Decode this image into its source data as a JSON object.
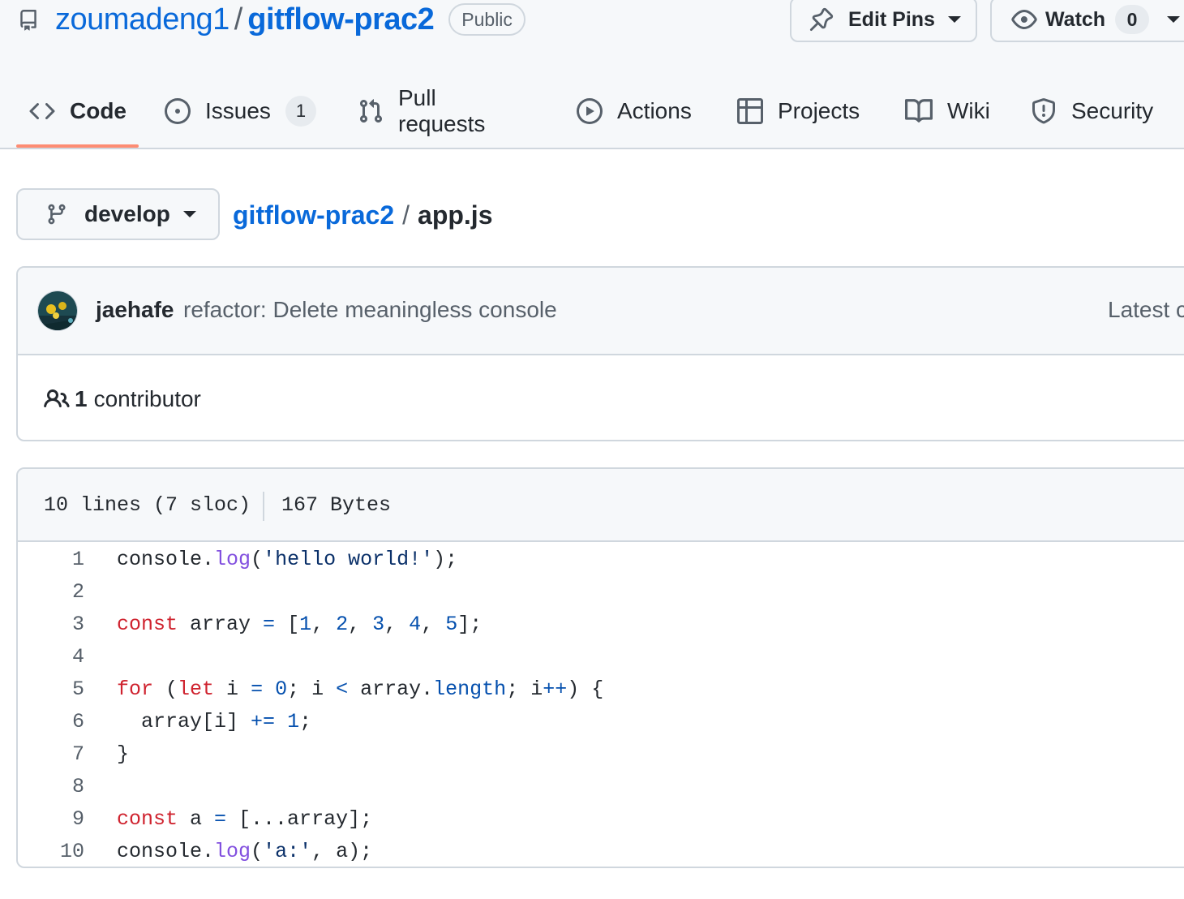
{
  "repo": {
    "owner": "zoumadeng1",
    "separator": "/",
    "name": "gitflow-prac2",
    "visibility": "Public",
    "edit_pins_label": "Edit Pins",
    "watch_label": "Watch",
    "watch_count": "0"
  },
  "tabs": [
    {
      "label": "Code",
      "icon": "code-icon",
      "selected": true
    },
    {
      "label": "Issues",
      "icon": "issue-opened-icon",
      "count": "1"
    },
    {
      "label": "Pull requests",
      "icon": "git-pull-request-icon"
    },
    {
      "label": "Actions",
      "icon": "play-icon"
    },
    {
      "label": "Projects",
      "icon": "table-icon"
    },
    {
      "label": "Wiki",
      "icon": "book-icon"
    },
    {
      "label": "Security",
      "icon": "shield-icon"
    }
  ],
  "file_nav": {
    "branch": "develop",
    "breadcrumb_root": "gitflow-prac2",
    "breadcrumb_sep": "/",
    "file_name": "app.js"
  },
  "commit": {
    "author": "jaehafe",
    "message": "refactor: Delete meaningless console",
    "latest_label": "Latest c",
    "contributors_count": "1",
    "contributors_label": "contributor"
  },
  "file_info": {
    "lines": "10 lines (7 sloc)",
    "size": "167 Bytes"
  },
  "code_lines": [
    {
      "n": "1",
      "tokens": [
        [
          "plain",
          "console."
        ],
        [
          "func",
          "log"
        ],
        [
          "plain",
          "("
        ],
        [
          "string",
          "'hello world!'"
        ],
        [
          "plain",
          ");"
        ]
      ]
    },
    {
      "n": "2",
      "tokens": []
    },
    {
      "n": "3",
      "tokens": [
        [
          "keyword",
          "const"
        ],
        [
          "plain",
          " array "
        ],
        [
          "op",
          "="
        ],
        [
          "plain",
          " ["
        ],
        [
          "number",
          "1"
        ],
        [
          "plain",
          ", "
        ],
        [
          "number",
          "2"
        ],
        [
          "plain",
          ", "
        ],
        [
          "number",
          "3"
        ],
        [
          "plain",
          ", "
        ],
        [
          "number",
          "4"
        ],
        [
          "plain",
          ", "
        ],
        [
          "number",
          "5"
        ],
        [
          "plain",
          "];"
        ]
      ]
    },
    {
      "n": "4",
      "tokens": []
    },
    {
      "n": "5",
      "tokens": [
        [
          "keyword",
          "for"
        ],
        [
          "plain",
          " ("
        ],
        [
          "keyword",
          "let"
        ],
        [
          "plain",
          " i "
        ],
        [
          "op",
          "="
        ],
        [
          "plain",
          " "
        ],
        [
          "number",
          "0"
        ],
        [
          "plain",
          "; i "
        ],
        [
          "op",
          "<"
        ],
        [
          "plain",
          " array."
        ],
        [
          "prop",
          "length"
        ],
        [
          "plain",
          "; i"
        ],
        [
          "op",
          "++"
        ],
        [
          "plain",
          ") {"
        ]
      ]
    },
    {
      "n": "6",
      "tokens": [
        [
          "plain",
          "  array[i] "
        ],
        [
          "op",
          "+="
        ],
        [
          "plain",
          " "
        ],
        [
          "number",
          "1"
        ],
        [
          "plain",
          ";"
        ]
      ]
    },
    {
      "n": "7",
      "tokens": [
        [
          "plain",
          "}"
        ]
      ]
    },
    {
      "n": "8",
      "tokens": []
    },
    {
      "n": "9",
      "tokens": [
        [
          "keyword",
          "const"
        ],
        [
          "plain",
          " a "
        ],
        [
          "op",
          "="
        ],
        [
          "plain",
          " [...array];"
        ]
      ]
    },
    {
      "n": "10",
      "tokens": [
        [
          "plain",
          "console."
        ],
        [
          "func",
          "log"
        ],
        [
          "plain",
          "("
        ],
        [
          "string",
          "'a:'"
        ],
        [
          "plain",
          ", a);"
        ]
      ]
    }
  ],
  "colors": {
    "link": "#0969da",
    "tab_underline": "#fd8c73",
    "keyword": "#cf222e",
    "function": "#8250df",
    "string": "#0a3069",
    "number": "#0550ae"
  }
}
